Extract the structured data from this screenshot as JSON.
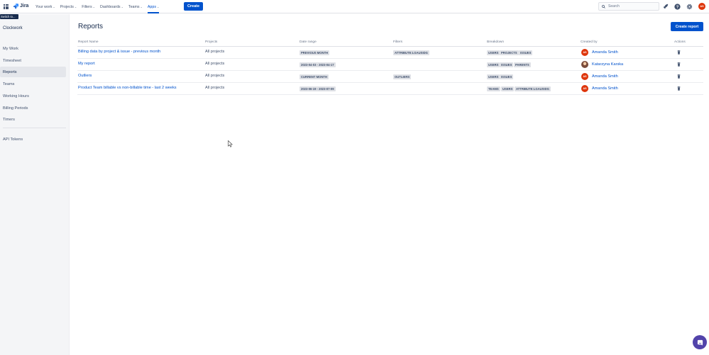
{
  "topnav": {
    "logo_text": "Jira",
    "items": [
      {
        "label": "Your work",
        "chevron": "⌄"
      },
      {
        "label": "Projects",
        "chevron": "⌄"
      },
      {
        "label": "Filters",
        "chevron": "⌄"
      },
      {
        "label": "Dashboards",
        "chevron": "⌄"
      },
      {
        "label": "Teams",
        "chevron": "⌄"
      },
      {
        "label": "Apps",
        "chevron": "⌄"
      }
    ],
    "active_item": "Apps",
    "create_label": "Create",
    "search_placeholder": "Search",
    "user_initials": "AS",
    "tooltip": "Switch to..."
  },
  "sidebar": {
    "title": "Clockwork",
    "items": [
      {
        "label": "My Work"
      },
      {
        "label": "Timesheet"
      },
      {
        "label": "Reports"
      },
      {
        "label": "Teams"
      },
      {
        "label": "Working Hours"
      },
      {
        "label": "Billing Periods"
      },
      {
        "label": "Timers"
      },
      {
        "label": "API Tokens"
      }
    ],
    "active_item": "Reports"
  },
  "main": {
    "title": "Reports",
    "create_report_label": "Create report",
    "columns": [
      "Report Name",
      "Projects",
      "Date range",
      "Filters",
      "Breakdown",
      "Created by",
      "Actions"
    ],
    "rows": [
      {
        "name": "Billing data by project & issue - previous month",
        "projects": "All projects",
        "date_range": "PREVIOUS MONTH",
        "filters": [
          "ATTRIBUTE:LGAUSIDG"
        ],
        "breakdown": [
          "USERS",
          "PROJECTS",
          "ISSUES"
        ],
        "created_by": {
          "name": "Amanda Smith",
          "initials": "AS"
        }
      },
      {
        "name": "My report",
        "projects": "All projects",
        "date_range": "2023-04-03 - 2023-04-17",
        "filters": [],
        "breakdown": [
          "USERS",
          "ISSUES",
          "PARENTS"
        ],
        "created_by": {
          "name": "Katarzyna Karska",
          "initials": ""
        }
      },
      {
        "name": "Outliers",
        "projects": "All projects",
        "date_range": "CURRENT MONTH",
        "filters": [
          "OUTLIERS"
        ],
        "breakdown": [
          "USERS",
          "ISSUES"
        ],
        "created_by": {
          "name": "Amanda Smith",
          "initials": "AS"
        }
      },
      {
        "name": "Product Team billable vs non-billable time - last 2 weeks",
        "projects": "All projects",
        "date_range": "2023-06-19 - 2023-07-09",
        "filters": [],
        "breakdown": [
          "TEAMS",
          "USERS",
          "ATTRIBUTE:LGAUSIDG"
        ],
        "created_by": {
          "name": "Amanda Smith",
          "initials": "AS"
        }
      }
    ]
  },
  "colors": {
    "brand": "#0052cc",
    "avatar": "#de350b",
    "chat": "#5243aa"
  }
}
